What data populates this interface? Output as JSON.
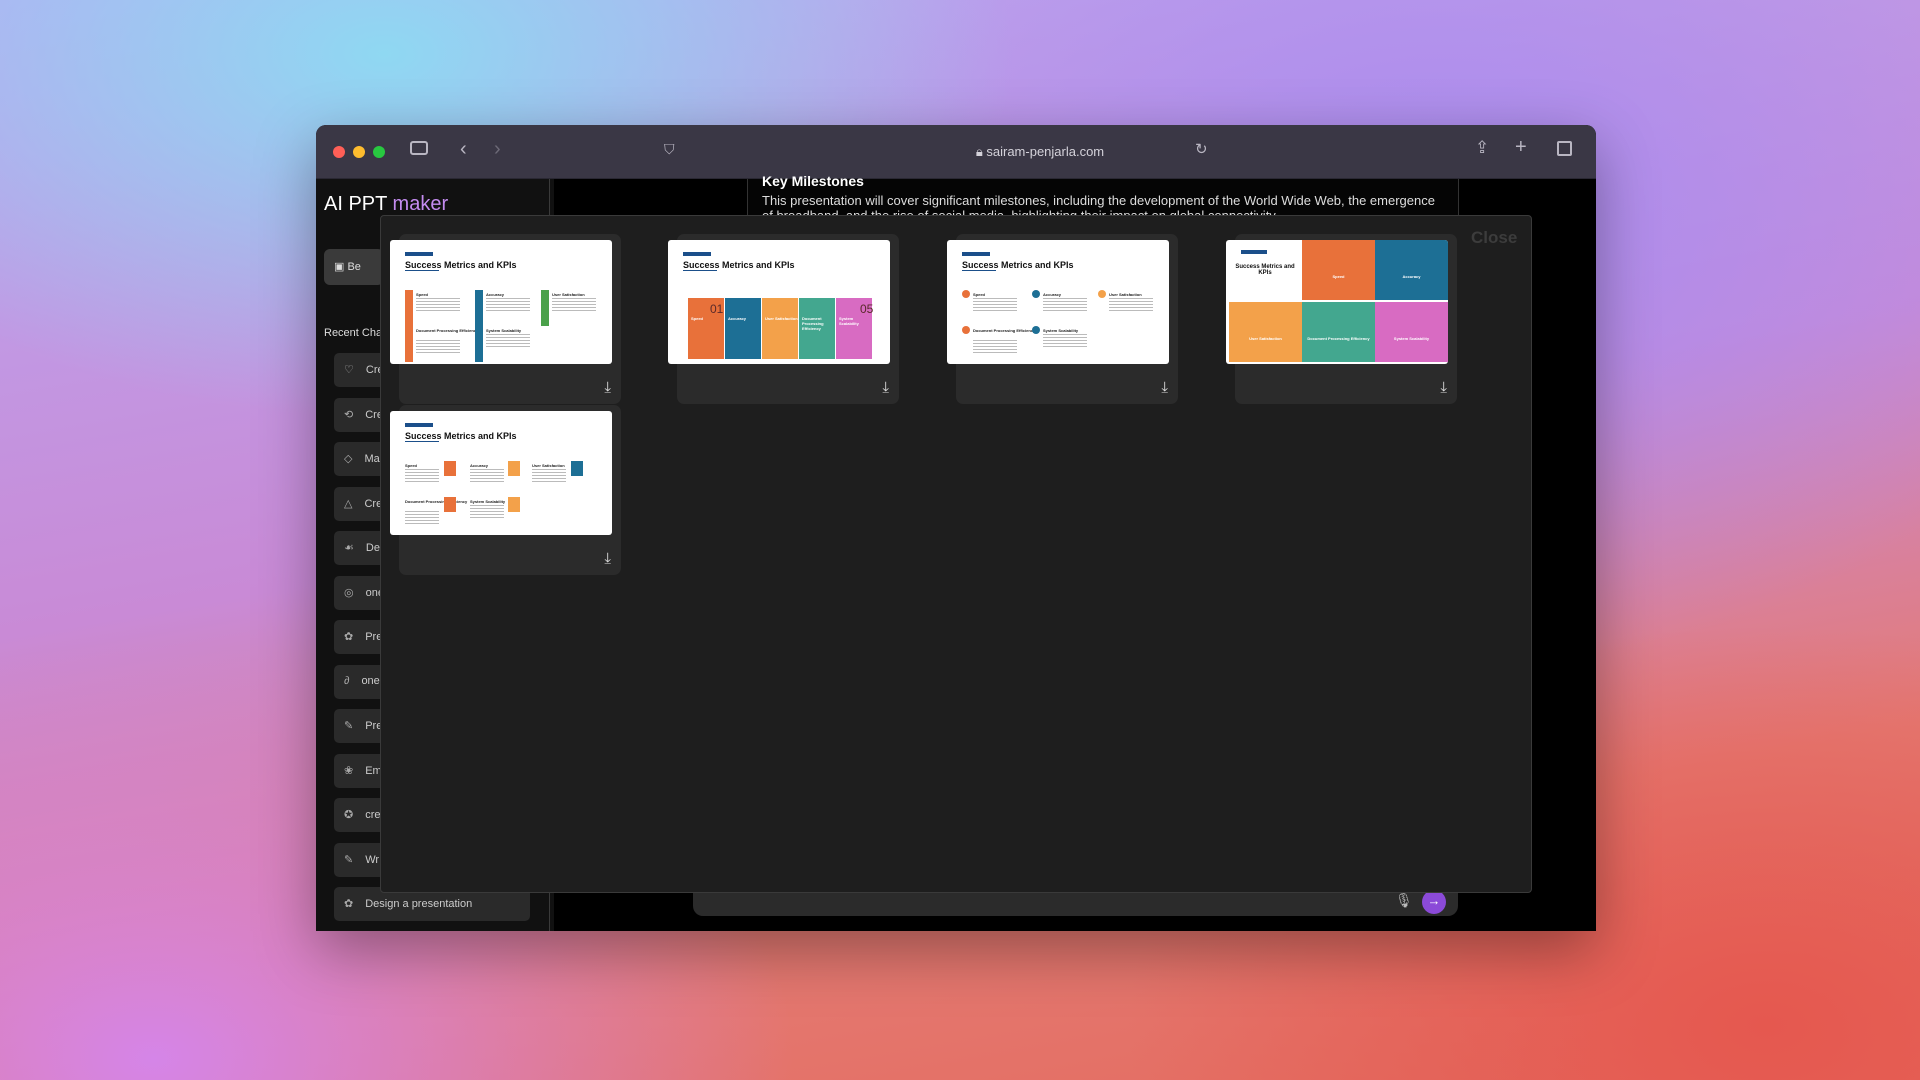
{
  "browser": {
    "url": "sairam-penjarla.com"
  },
  "app": {
    "brand_prefix": "AI PPT ",
    "brand_accent": "maker",
    "begin_label": "Be",
    "recent_label": "Recent Chat",
    "chats": [
      {
        "icon": "♡",
        "label": "Cre"
      },
      {
        "icon": "⟲",
        "label": "Cre"
      },
      {
        "icon": "◇",
        "label": "Ma"
      },
      {
        "icon": "△",
        "label": "Cre"
      },
      {
        "icon": "☙",
        "label": "De"
      },
      {
        "icon": "◎",
        "label": "one"
      },
      {
        "icon": "✿",
        "label": "Pre"
      },
      {
        "icon": "∂",
        "label": "one"
      },
      {
        "icon": "✎",
        "label": "Pre"
      },
      {
        "icon": "❀",
        "label": "Em"
      },
      {
        "icon": "✪",
        "label": "cre"
      },
      {
        "icon": "✎",
        "label": "Wr"
      },
      {
        "icon": "✿",
        "label": "Design a presentation"
      }
    ]
  },
  "content": {
    "heading": "Key Milestones",
    "paragraph": "This presentation will cover significant milestones, including the development of the World Wide Web, the emergence of broadband, and the rise of social media, highlighting their impact on global connectivity."
  },
  "modal": {
    "close_label": "Close",
    "slide_title": "Success Metrics and KPIs",
    "metrics": [
      "Speed",
      "Accuracy",
      "User Satisfaction",
      "Document Processing Efficiency",
      "System Scalability"
    ],
    "numbers": [
      "01",
      "05"
    ]
  },
  "colors": {
    "orange": "#e8713a",
    "blue": "#1d6f95",
    "amber": "#f3a14a",
    "teal": "#43a78f",
    "pink": "#d86bc2",
    "green": "#4aa14a",
    "purple": "#8b4ad8"
  }
}
